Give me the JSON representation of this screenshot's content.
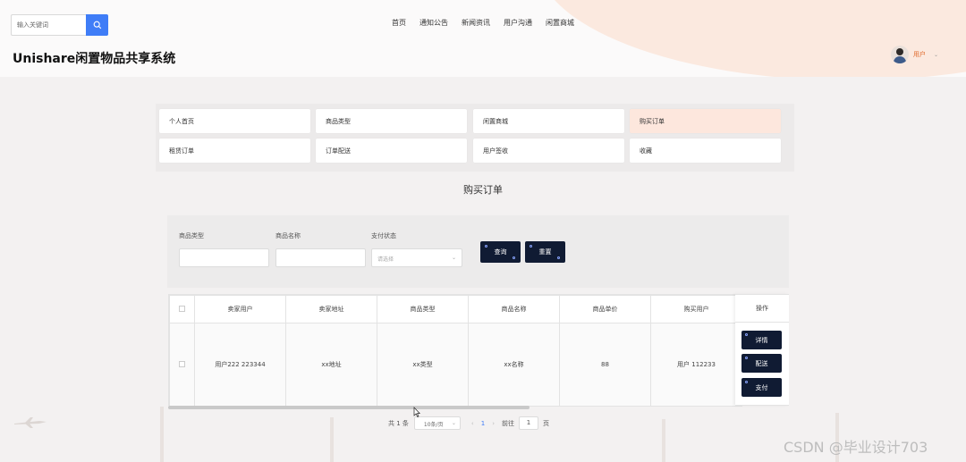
{
  "header": {
    "search_placeholder": "输入关键词",
    "site_title": "Unishare闲置物品共享系统",
    "nav": [
      "首页",
      "通知公告",
      "新闻资讯",
      "用户沟通",
      "闲置商城"
    ],
    "user_name": "用户",
    "user_caret": "⌄"
  },
  "menu": {
    "items": [
      "个人首页",
      "商品类型",
      "闲置商城",
      "购买订单",
      "租赁订单",
      "订单配送",
      "用户签收",
      "收藏"
    ],
    "active": "购买订单"
  },
  "page_title": "购买订单",
  "filters": {
    "labels": [
      "商品类型",
      "商品名称",
      "支付状态"
    ],
    "select_placeholder": "请选择",
    "query_button": "查询",
    "reset_button": "重置"
  },
  "table": {
    "columns": [
      "卖家用户",
      "卖家地址",
      "商品类型",
      "商品名称",
      "商品单价",
      "购买用户"
    ],
    "ops_header": "操作",
    "rows": [
      {
        "cells": [
          "用户222 223344",
          "xx地址",
          "xx类型",
          "xx名称",
          "88",
          "用户 112233"
        ]
      }
    ],
    "row_actions": [
      "详情",
      "配送",
      "支付"
    ]
  },
  "pagination": {
    "total": "共 1 条",
    "page_size": "10条/页",
    "current_page": "1",
    "goto_label": "前往",
    "goto_value": "1",
    "page_suffix": "页",
    "prev_icon": "‹",
    "next_icon": "›",
    "caret": "⌄"
  },
  "watermark": "CSDN @毕业设计703",
  "colors": {
    "accent_blue": "#3f7df7",
    "dark_button": "#101b33",
    "active_menu": "#fde7dd",
    "header_blob": "#fbe9df",
    "user_name": "#e06a2c"
  },
  "icons": {
    "search": "search-icon",
    "avatar": "avatar",
    "caret": "chevron-down-icon"
  }
}
